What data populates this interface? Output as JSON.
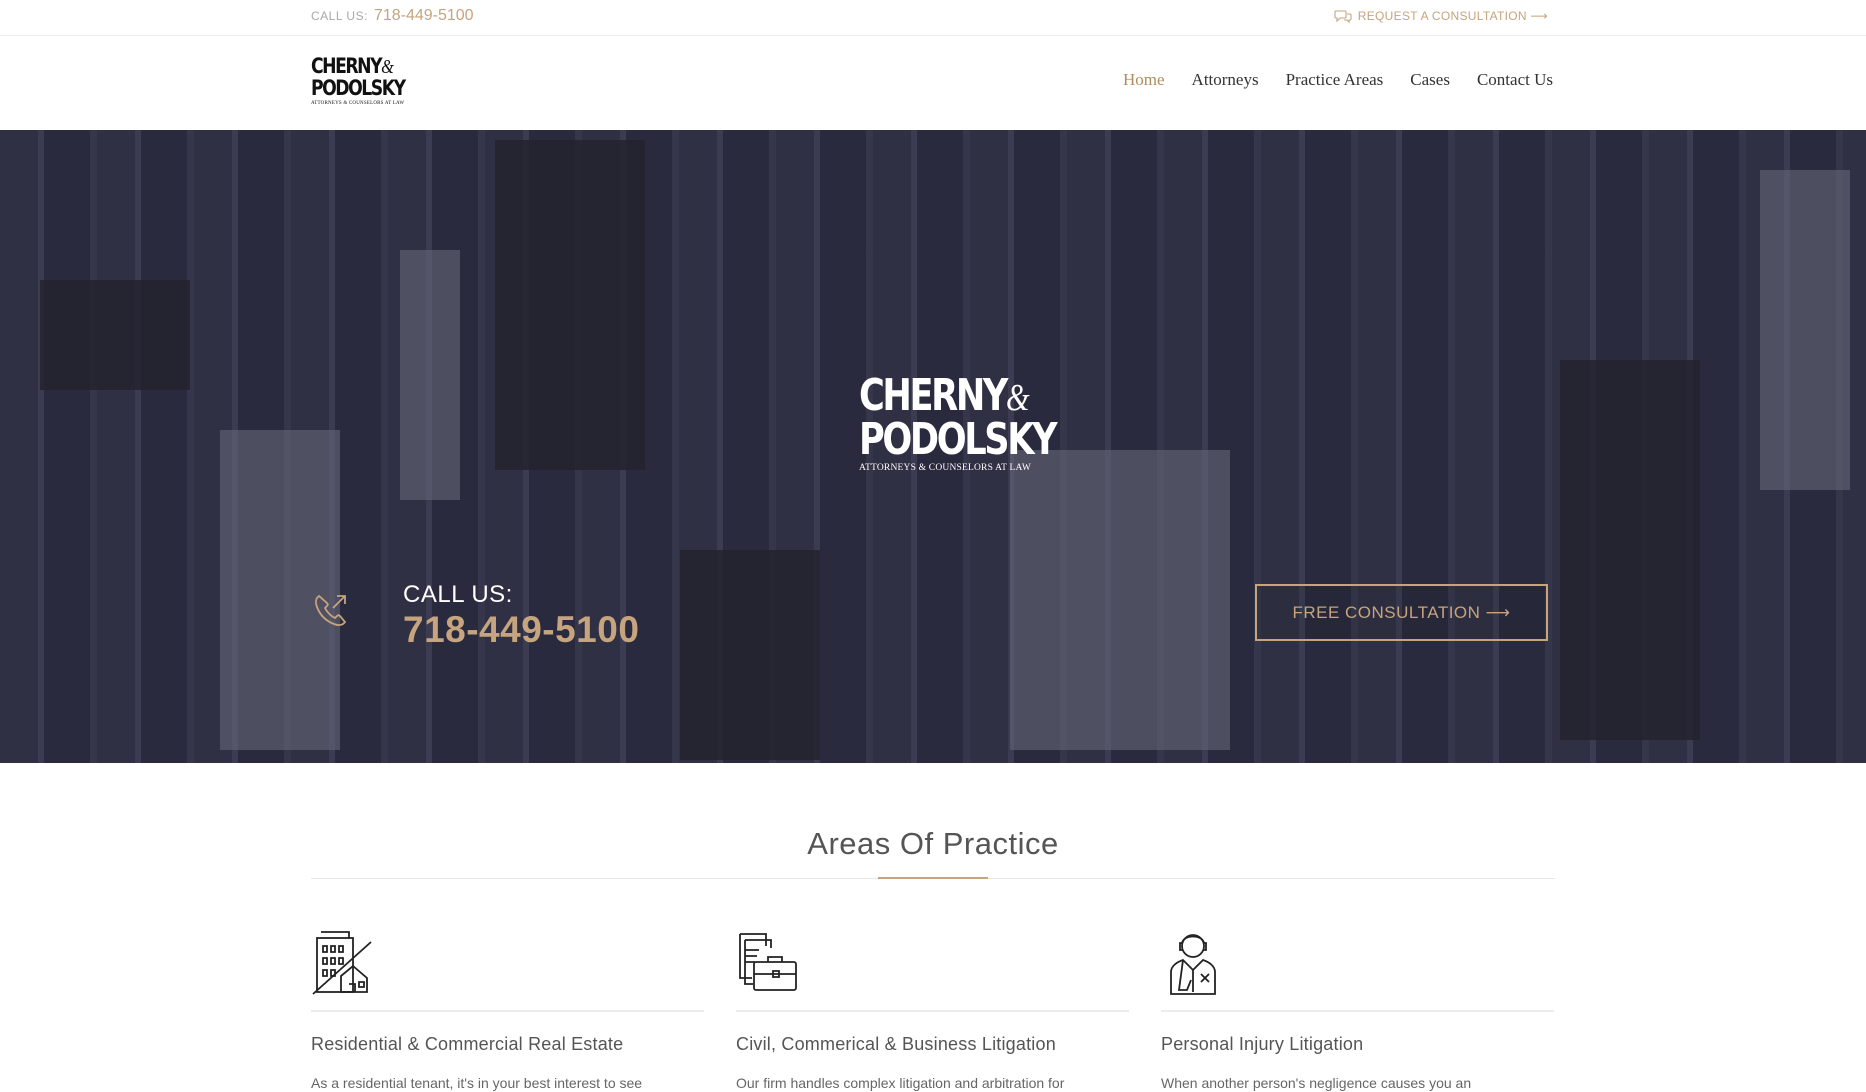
{
  "topbar": {
    "call_label": "CALL US:",
    "phone": "718-449-5100",
    "request": "REQUEST A CONSULTATION ⟶"
  },
  "logo": {
    "line1": "CHERNY",
    "amp": "&",
    "line2": "PODOLSKY",
    "tagline": "ATTORNEYS & COUNSELORS AT LAW"
  },
  "nav": {
    "items": [
      "Home",
      "Attorneys",
      "Practice Areas",
      "Cases",
      "Contact Us"
    ],
    "active": "Home"
  },
  "hero": {
    "call_label": "CALL US:",
    "phone": "718-449-5100",
    "button": "FREE CONSULTATION ⟶"
  },
  "areas": {
    "title": "Areas Of Practice",
    "cards": [
      {
        "icon": "building-icon",
        "title": "Residential & Commercial Real Estate",
        "text": "As a residential tenant, it's in your best interest to see"
      },
      {
        "icon": "briefcase-documents-icon",
        "title": "Civil, Commerical & Business Litigation",
        "text": "Our firm handles complex litigation and arbitration for"
      },
      {
        "icon": "injured-person-icon",
        "title": "Personal Injury Litigation",
        "text": "When another person's negligence causes you an"
      }
    ]
  },
  "colors": {
    "accent": "#c5a47e",
    "nav_active": "#b08d5e",
    "hero_overlay": "#26263c"
  }
}
